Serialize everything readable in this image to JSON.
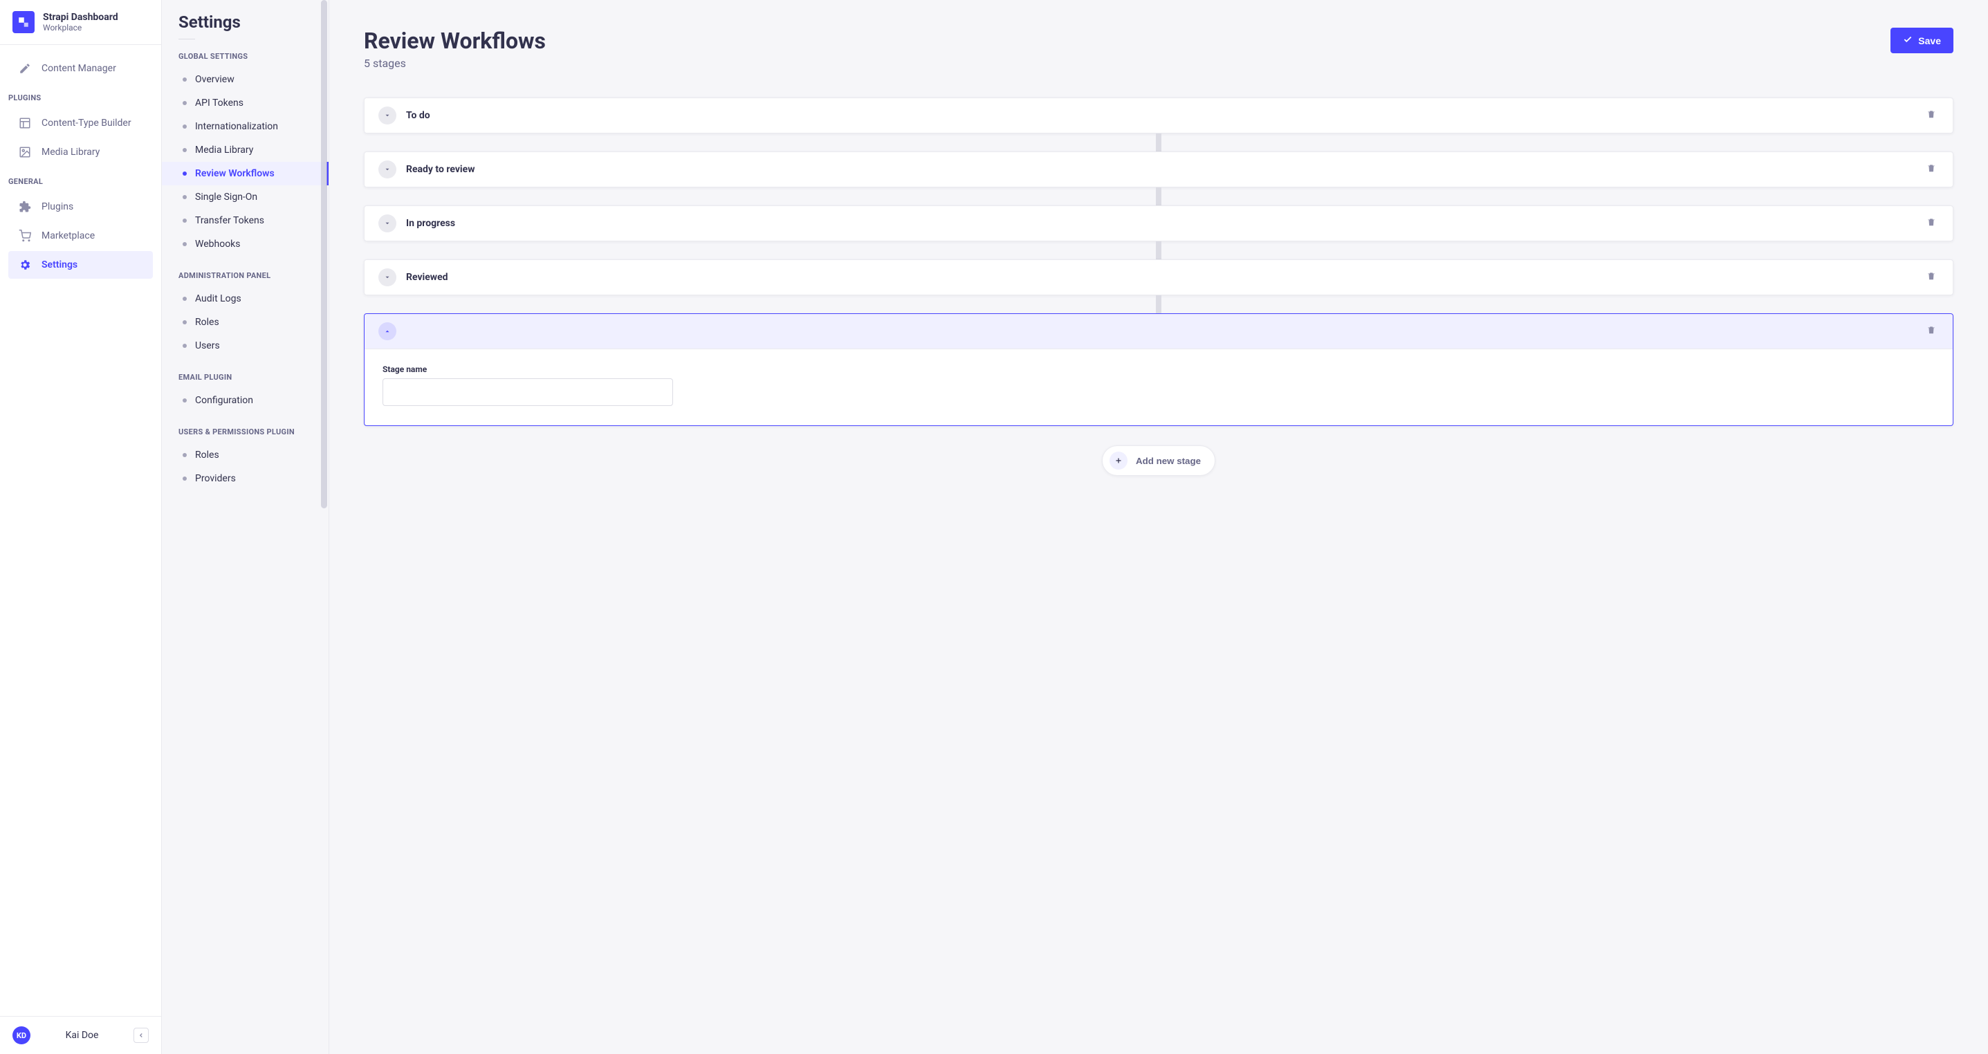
{
  "brand": {
    "title": "Strapi Dashboard",
    "subtitle": "Workplace"
  },
  "sidebar": {
    "content_manager": "Content Manager",
    "plugins_label": "PLUGINS",
    "content_type_builder": "Content-Type Builder",
    "media_library": "Media Library",
    "general_label": "GENERAL",
    "plugins": "Plugins",
    "marketplace": "Marketplace",
    "settings": "Settings"
  },
  "user": {
    "initials": "KD",
    "name": "Kai Doe"
  },
  "subnav": {
    "title": "Settings",
    "groups": [
      {
        "label": "GLOBAL SETTINGS",
        "items": [
          {
            "label": "Overview"
          },
          {
            "label": "API Tokens"
          },
          {
            "label": "Internationalization"
          },
          {
            "label": "Media Library"
          },
          {
            "label": "Review Workflows",
            "active": true
          },
          {
            "label": "Single Sign-On"
          },
          {
            "label": "Transfer Tokens"
          },
          {
            "label": "Webhooks"
          }
        ]
      },
      {
        "label": "ADMINISTRATION PANEL",
        "items": [
          {
            "label": "Audit Logs"
          },
          {
            "label": "Roles"
          },
          {
            "label": "Users"
          }
        ]
      },
      {
        "label": "EMAIL PLUGIN",
        "items": [
          {
            "label": "Configuration"
          }
        ]
      },
      {
        "label": "USERS & PERMISSIONS PLUGIN",
        "items": [
          {
            "label": "Roles"
          },
          {
            "label": "Providers"
          }
        ]
      }
    ]
  },
  "main": {
    "title": "Review Workflows",
    "subtitle": "5 stages",
    "save_label": "Save",
    "stages": [
      {
        "name": "To do"
      },
      {
        "name": "Ready to review"
      },
      {
        "name": "In progress"
      },
      {
        "name": "Reviewed"
      }
    ],
    "open_stage": {
      "field_label": "Stage name",
      "value": ""
    },
    "add_stage_label": "Add new stage"
  }
}
